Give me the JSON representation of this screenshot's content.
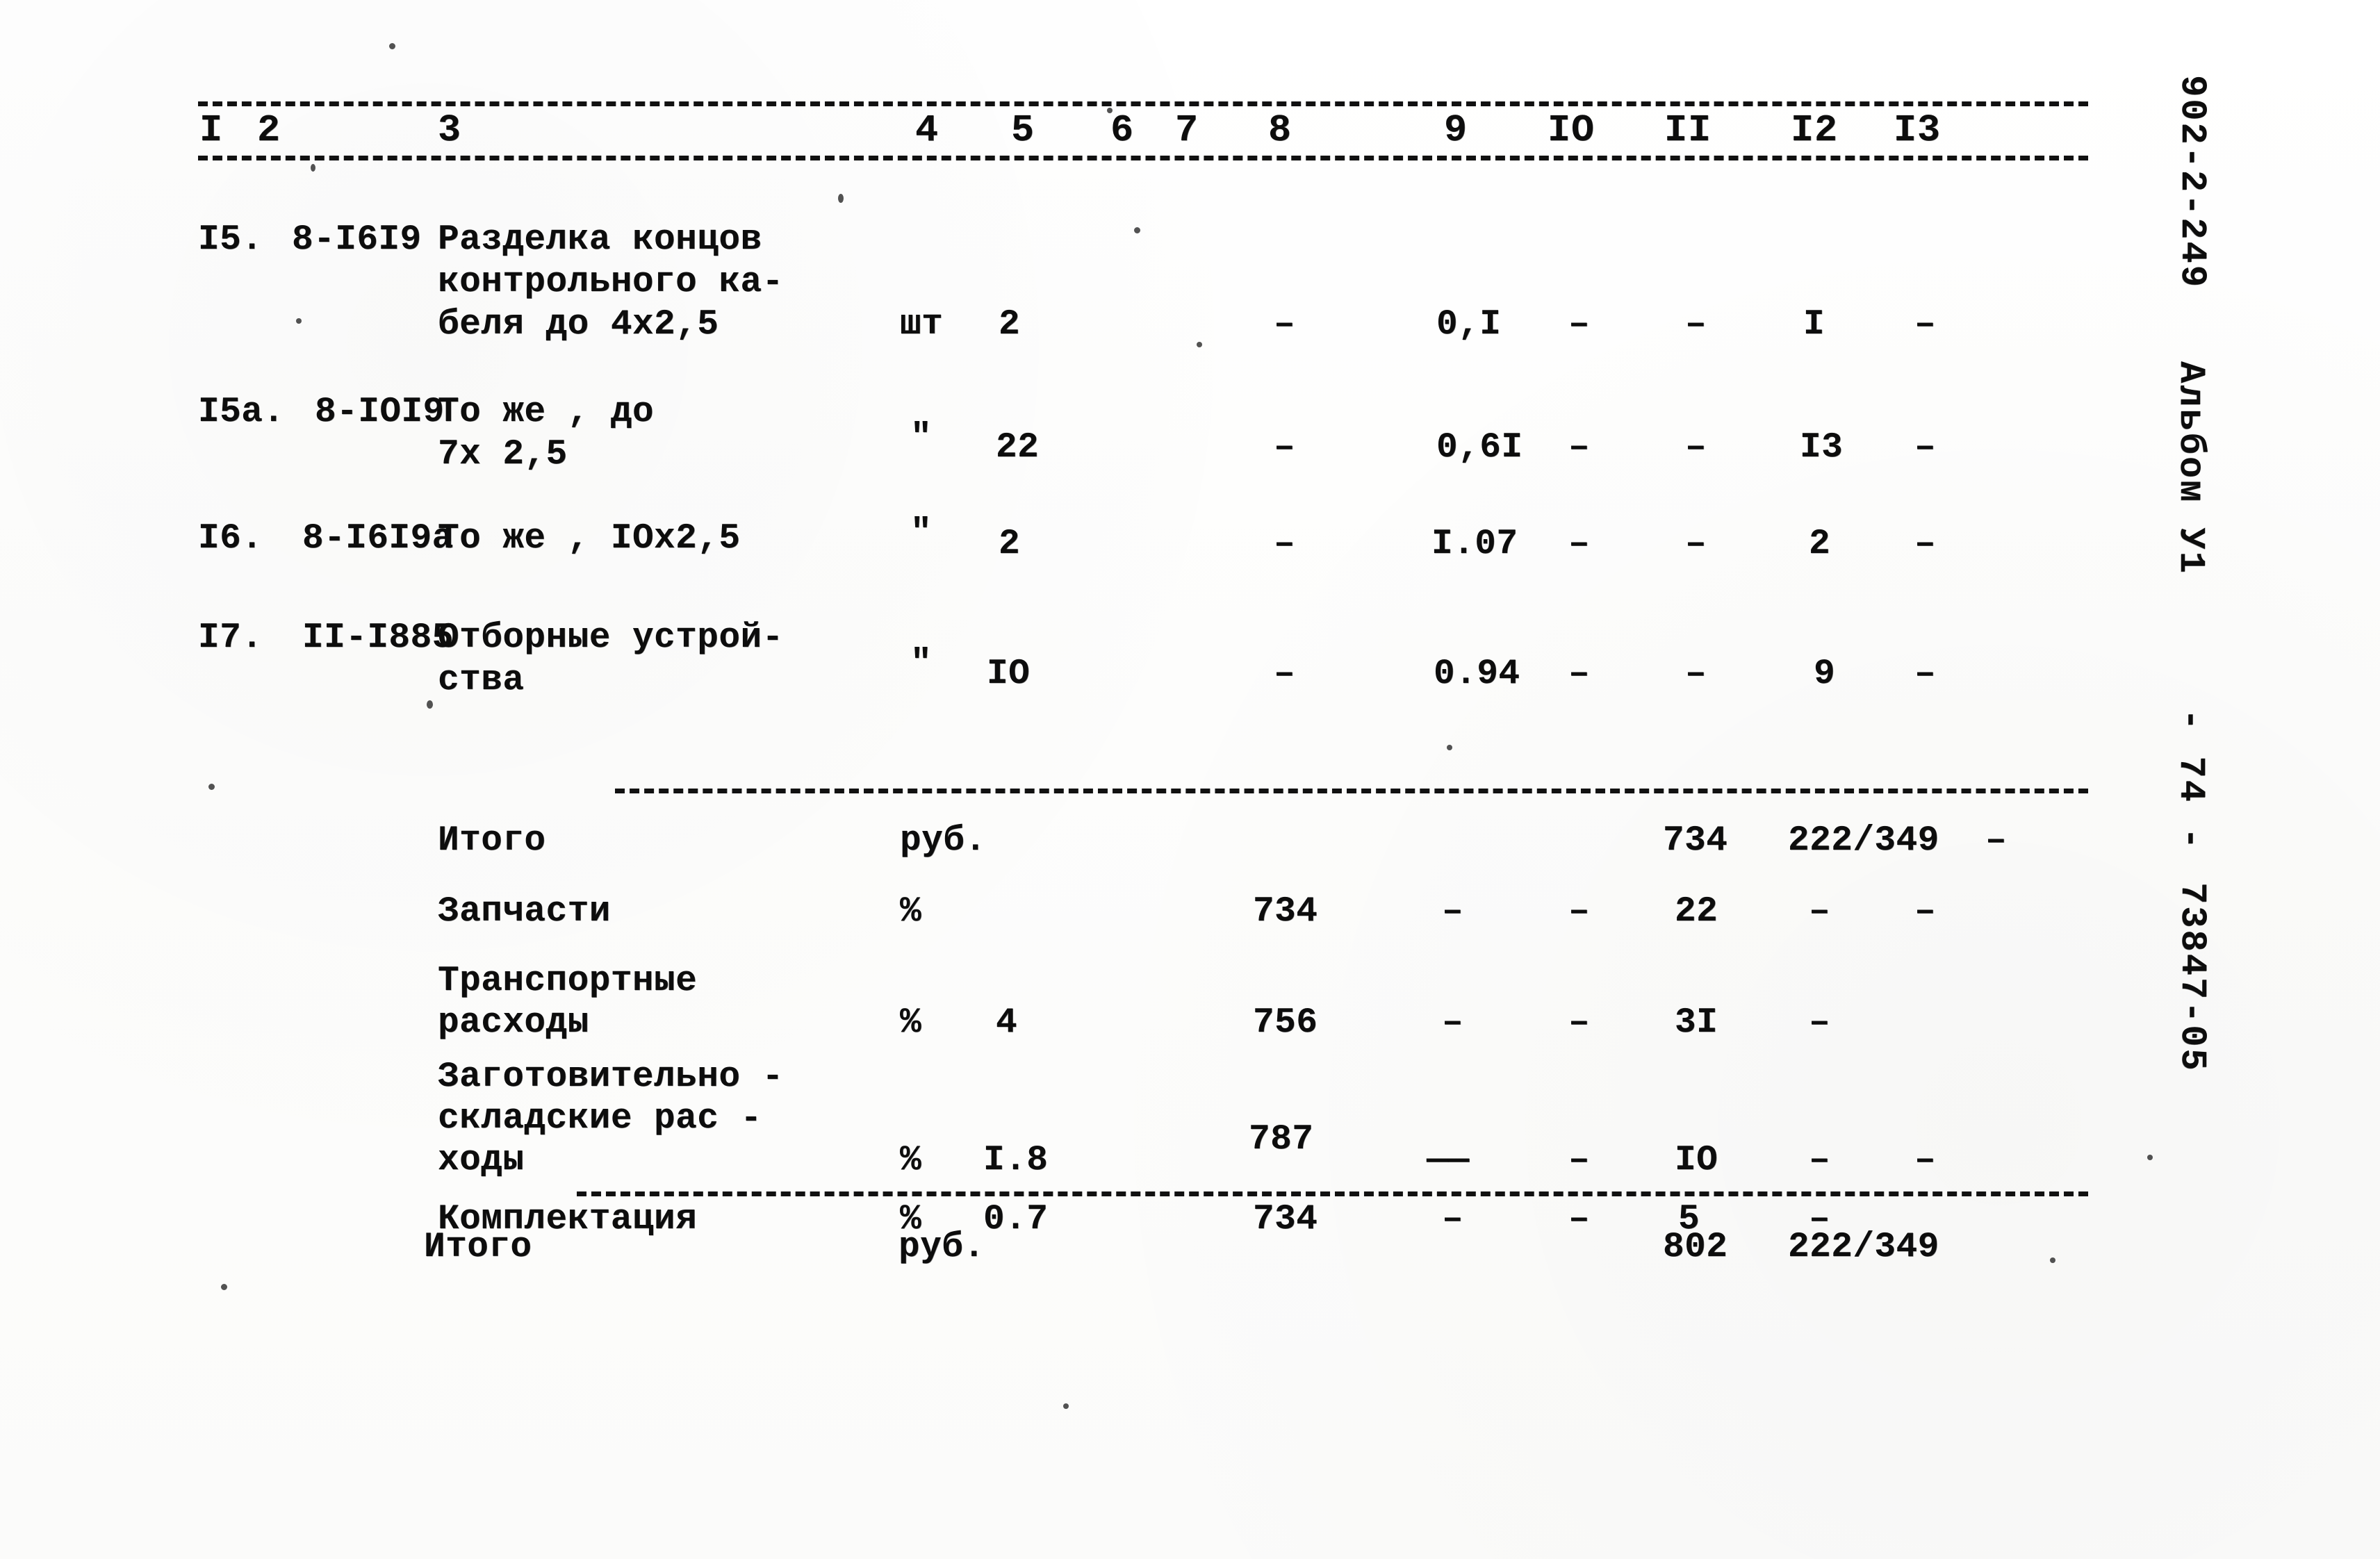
{
  "document": {
    "kind": "scanned-estimate-table",
    "language": "ru"
  },
  "table": {
    "column_headers": [
      "I",
      "2",
      "3",
      "4",
      "5",
      "6",
      "7",
      "8",
      "9",
      "IO",
      "II",
      "I2",
      "I3"
    ],
    "rows": [
      {
        "num": "I5.",
        "code": "8-I6I9",
        "name_lines": [
          "Разделка концов",
          "контрольного ка-",
          "беля до 4х2,5"
        ],
        "c4": "шт",
        "c5": "2",
        "c6": "",
        "c7": "",
        "c8": "–",
        "c9": "0,I",
        "c10": "–",
        "c11": "–",
        "c12": "I",
        "c13": "–"
      },
      {
        "num": "I5а.",
        "code": "8-IOI9",
        "name_lines": [
          "То же , до",
          "7х 2,5"
        ],
        "c4": "\"",
        "c5": "22",
        "c6": "",
        "c7": "",
        "c8": "–",
        "c9": "0,6I",
        "c10": "–",
        "c11": "–",
        "c12": "I3",
        "c13": "–"
      },
      {
        "num": "I6.",
        "code": "8-I6I9а",
        "name_lines": [
          "То же , IOх2,5"
        ],
        "c4": "\"",
        "c5": "2",
        "c6": "",
        "c7": "",
        "c8": "–",
        "c9": "I.07",
        "c10": "–",
        "c11": "–",
        "c12": "2",
        "c13": "–"
      },
      {
        "num": "I7.",
        "code": "II-I885",
        "name_lines": [
          "Отборные устрой-",
          "ства"
        ],
        "c4": "\"",
        "c5": "IO",
        "c6": "",
        "c7": "",
        "c8": "–",
        "c9": "0.94",
        "c10": "–",
        "c11": "–",
        "c12": "9",
        "c13": "–"
      }
    ],
    "summary_rows": [
      {
        "name_lines": [
          "Итого"
        ],
        "unit": "руб.",
        "c5": "",
        "c8": "",
        "c9": "",
        "c10": "",
        "c11": "734",
        "c12": "222/349",
        "c13": "–"
      },
      {
        "name_lines": [
          "Запчасти"
        ],
        "unit": "%",
        "c5": "",
        "c8": "734",
        "c9": "–",
        "c10": "–",
        "c11": "22",
        "c12": "–",
        "c13": "–"
      },
      {
        "name_lines": [
          "Транспортные",
          "расходы"
        ],
        "unit": "%",
        "c5": "4",
        "c8": "756",
        "c9": "–",
        "c10": "–",
        "c11": "3I",
        "c12": "–",
        "c13": ""
      },
      {
        "name_lines": [
          "Заготовительно -",
          "складские рас -",
          "ходы"
        ],
        "unit": "%",
        "c5": "I.8",
        "c8": "787",
        "c9": "——",
        "c10": "–",
        "c11": "IO",
        "c12": "–",
        "c13": "–"
      },
      {
        "name_lines": [
          "Комплектация"
        ],
        "unit": "%",
        "c5": "0.7",
        "c8": "734",
        "c9": "–",
        "c10": "–",
        "c11": "5",
        "c12": "–",
        "c13": ""
      }
    ],
    "final_row": {
      "name": "Итого",
      "unit": "руб.",
      "c11": "802",
      "c12": "222/349"
    }
  },
  "margin": {
    "project_code": "902-2-249",
    "album": "Альбом У1",
    "page": "- 74 -",
    "archive_code": "73847-05"
  }
}
